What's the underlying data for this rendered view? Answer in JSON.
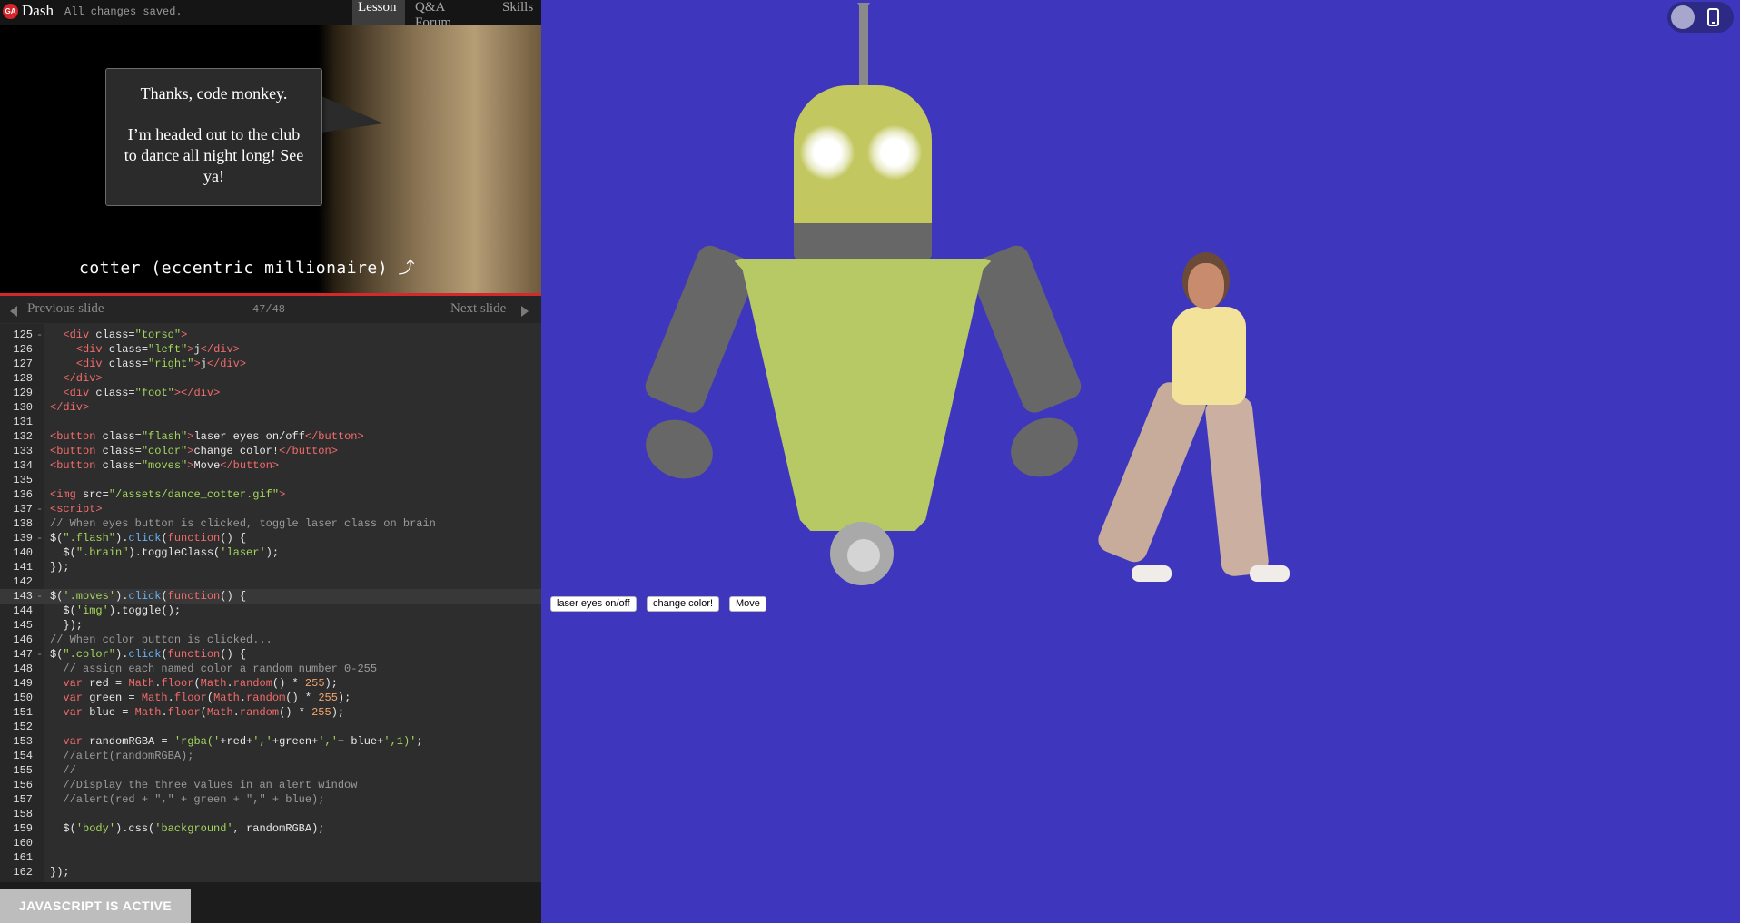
{
  "header": {
    "logo": "GA",
    "app_name": "Dash",
    "status": "All changes saved.",
    "tabs": [
      {
        "label": "Lesson",
        "active": true
      },
      {
        "label": "Q&A Forum",
        "active": false
      },
      {
        "label": "Skills",
        "active": false
      }
    ]
  },
  "slide": {
    "bubble_line1": "Thanks, code monkey.",
    "bubble_line2": "I’m headed out to the club to dance all night long! See ya!",
    "caption": "cotter (eccentric millionaire) ⤴"
  },
  "slide_nav": {
    "previous_label": "Previous slide",
    "next_label": "Next slide",
    "counter": "47/48"
  },
  "editor": {
    "current_line": "143",
    "lines": [
      {
        "n": "125",
        "fold": "-",
        "html": "  <span class='t'>&lt;div</span> <span class='a'>class=</span><span class='s'>\"torso\"</span><span class='t'>&gt;</span>"
      },
      {
        "n": "126",
        "fold": "",
        "html": "    <span class='t'>&lt;div</span> <span class='a'>class=</span><span class='s'>\"left\"</span><span class='t'>&gt;</span>j<span class='t'>&lt;/div&gt;</span>"
      },
      {
        "n": "127",
        "fold": "",
        "html": "    <span class='t'>&lt;div</span> <span class='a'>class=</span><span class='s'>\"right\"</span><span class='t'>&gt;</span>j<span class='t'>&lt;/div&gt;</span>"
      },
      {
        "n": "128",
        "fold": "",
        "html": "  <span class='t'>&lt;/div&gt;</span>"
      },
      {
        "n": "129",
        "fold": "",
        "html": "  <span class='t'>&lt;div</span> <span class='a'>class=</span><span class='s'>\"foot\"</span><span class='t'>&gt;&lt;/div&gt;</span>"
      },
      {
        "n": "130",
        "fold": "",
        "html": "<span class='t'>&lt;/div&gt;</span>"
      },
      {
        "n": "131",
        "fold": "",
        "html": ""
      },
      {
        "n": "132",
        "fold": "",
        "html": "<span class='t'>&lt;button</span> <span class='a'>class=</span><span class='s'>\"flash\"</span><span class='t'>&gt;</span>laser eyes on/off<span class='t'>&lt;/button&gt;</span>"
      },
      {
        "n": "133",
        "fold": "",
        "html": "<span class='t'>&lt;button</span> <span class='a'>class=</span><span class='s'>\"color\"</span><span class='t'>&gt;</span>change color!<span class='t'>&lt;/button&gt;</span>"
      },
      {
        "n": "134",
        "fold": "",
        "html": "<span class='t'>&lt;button</span> <span class='a'>class=</span><span class='s'>\"moves\"</span><span class='t'>&gt;</span>Move<span class='t'>&lt;/button&gt;</span>"
      },
      {
        "n": "135",
        "fold": "",
        "html": ""
      },
      {
        "n": "136",
        "fold": "",
        "html": "<span class='t'>&lt;img</span> <span class='a'>src=</span><span class='s'>\"/assets/dance_cotter.gif\"</span><span class='t'>&gt;</span>"
      },
      {
        "n": "137",
        "fold": "-",
        "html": "<span class='t'>&lt;script&gt;</span>"
      },
      {
        "n": "138",
        "fold": "",
        "html": "<span class='c'>// When eyes button is clicked, toggle laser class on brain</span>"
      },
      {
        "n": "139",
        "fold": "-",
        "html": "$(<span class='s'>\".flash\"</span>).<span class='f'>click</span>(<span class='k'>function</span>() {"
      },
      {
        "n": "140",
        "fold": "",
        "html": "  $(<span class='s'>\".brain\"</span>).toggleClass(<span class='s'>'laser'</span>);"
      },
      {
        "n": "141",
        "fold": "",
        "html": "});"
      },
      {
        "n": "142",
        "fold": "",
        "html": ""
      },
      {
        "n": "143",
        "fold": "-",
        "html": "$(<span class='s'>'.moves'</span>).<span class='f'>click</span>(<span class='k'>function</span>() {"
      },
      {
        "n": "144",
        "fold": "",
        "html": "  $(<span class='s'>'img'</span>).toggle();"
      },
      {
        "n": "145",
        "fold": "",
        "html": "  });"
      },
      {
        "n": "146",
        "fold": "",
        "html": "<span class='c'>// When color button is clicked...</span>"
      },
      {
        "n": "147",
        "fold": "-",
        "html": "$(<span class='s'>\".color\"</span>).<span class='f'>click</span>(<span class='k'>function</span>() {"
      },
      {
        "n": "148",
        "fold": "",
        "html": "  <span class='c'>// assign each named color a random number 0-255</span>"
      },
      {
        "n": "149",
        "fold": "",
        "html": "  <span class='k'>var</span> red = <span class='k'>Math</span>.<span class='k'>floor</span>(<span class='k'>Math</span>.<span class='k'>random</span>() * <span class='n'>255</span>);"
      },
      {
        "n": "150",
        "fold": "",
        "html": "  <span class='k'>var</span> green = <span class='k'>Math</span>.<span class='k'>floor</span>(<span class='k'>Math</span>.<span class='k'>random</span>() * <span class='n'>255</span>);"
      },
      {
        "n": "151",
        "fold": "",
        "html": "  <span class='k'>var</span> blue = <span class='k'>Math</span>.<span class='k'>floor</span>(<span class='k'>Math</span>.<span class='k'>random</span>() * <span class='n'>255</span>);"
      },
      {
        "n": "152",
        "fold": "",
        "html": ""
      },
      {
        "n": "153",
        "fold": "",
        "html": "  <span class='k'>var</span> randomRGBA = <span class='s'>'rgba('</span>+red+<span class='s'>','</span>+green+<span class='s'>','</span>+ blue+<span class='s'>',1)'</span>;"
      },
      {
        "n": "154",
        "fold": "",
        "html": "  <span class='c'>//alert(randomRGBA);</span>"
      },
      {
        "n": "155",
        "fold": "",
        "html": "  <span class='c'>//</span>"
      },
      {
        "n": "156",
        "fold": "",
        "html": "  <span class='c'>//Display the three values in an alert window</span>"
      },
      {
        "n": "157",
        "fold": "",
        "html": "  <span class='c'>//alert(red + \",\" + green + \",\" + blue);</span>"
      },
      {
        "n": "158",
        "fold": "",
        "html": ""
      },
      {
        "n": "159",
        "fold": "",
        "html": "  $(<span class='s'>'body'</span>).css(<span class='s'>'background'</span>, randomRGBA);"
      },
      {
        "n": "160",
        "fold": "",
        "html": ""
      },
      {
        "n": "161",
        "fold": "",
        "html": ""
      },
      {
        "n": "162",
        "fold": "",
        "html": "});"
      }
    ]
  },
  "bottom": {
    "js_status": "JAVASCRIPT IS ACTIVE"
  },
  "preview": {
    "background_color": "#3e37be",
    "view_toggle_icon": "phone-icon",
    "buttons": {
      "flash": "laser eyes on/off",
      "color": "change color!",
      "moves": "Move"
    }
  }
}
